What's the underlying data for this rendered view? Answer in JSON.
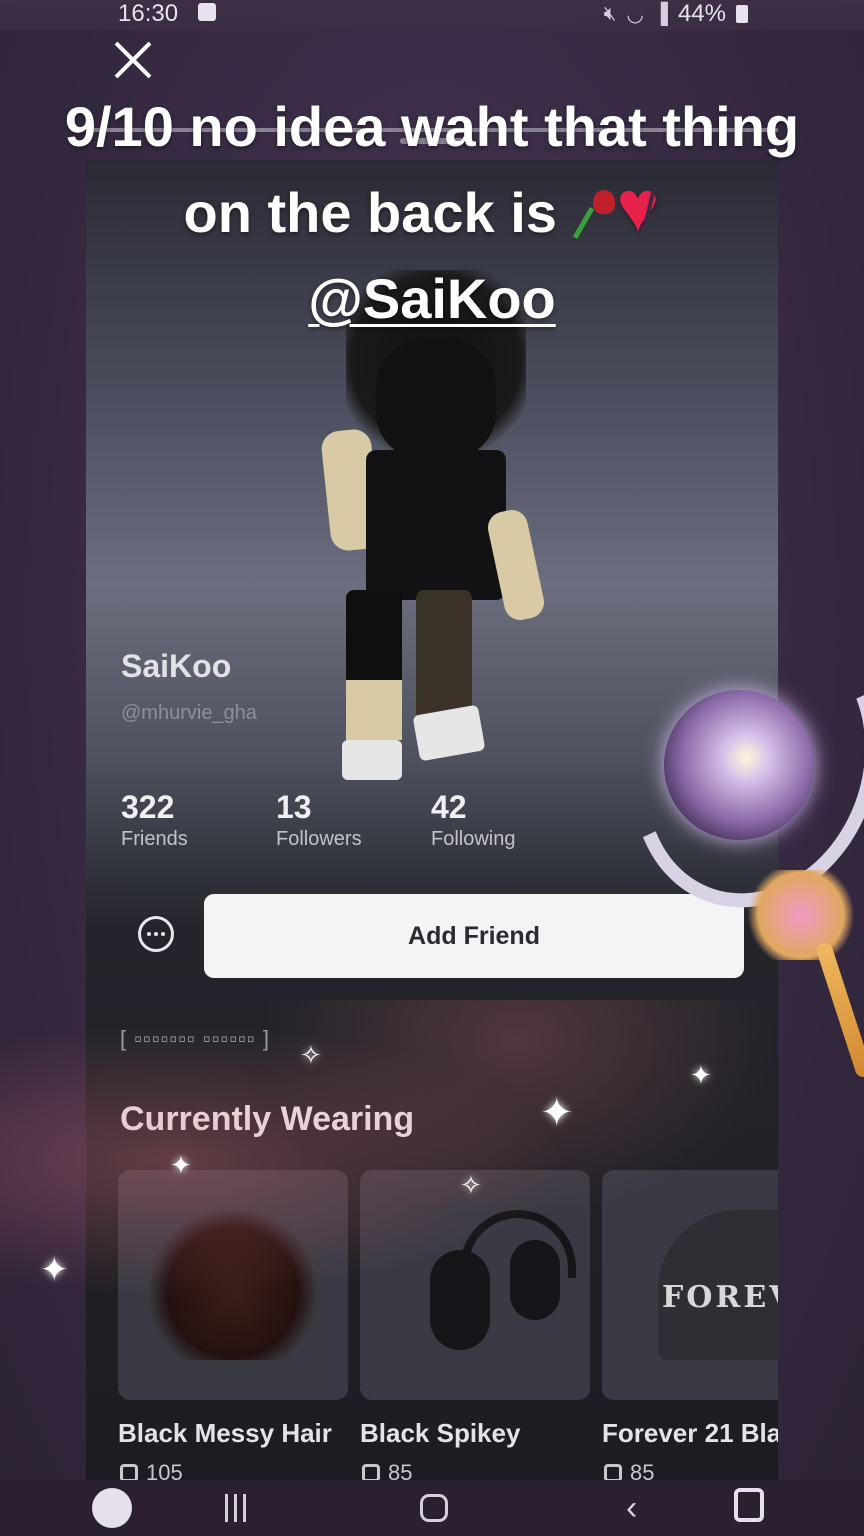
{
  "status_bar": {
    "time": "16:30",
    "battery": "44%",
    "icons": [
      "notification-icon",
      "mute-icon",
      "wifi-icon",
      "signal-icon",
      "battery-icon"
    ]
  },
  "caption": {
    "line1": "9/10 no idea waht that thing",
    "line2": "on the back is",
    "mention": "@SaiKoo",
    "emojis": [
      "wilted-rose-emoji",
      "broken-heart-emoji"
    ]
  },
  "profile": {
    "display_name": "SaiKoo",
    "username": "@mhurvie_gha",
    "stats": [
      {
        "value": "322",
        "label": "Friends"
      },
      {
        "value": "13",
        "label": "Followers"
      },
      {
        "value": "42",
        "label": "Following"
      }
    ],
    "add_friend_label": "Add Friend",
    "bio": "[ ▫▫▫▫▫▫▫ ▫▫▫▫▫▫ ]"
  },
  "wearing": {
    "title": "Currently Wearing",
    "items": [
      {
        "name": "Black Messy Hair",
        "price": "105"
      },
      {
        "name": "Black Spikey",
        "price": "85"
      },
      {
        "name": "Forever 21 Bla",
        "price": "85",
        "art_text": "FOREVER"
      }
    ]
  },
  "colors": {
    "background": "#3a2c46",
    "button": "#f4f4f6",
    "text_primary": "#ececf0"
  }
}
